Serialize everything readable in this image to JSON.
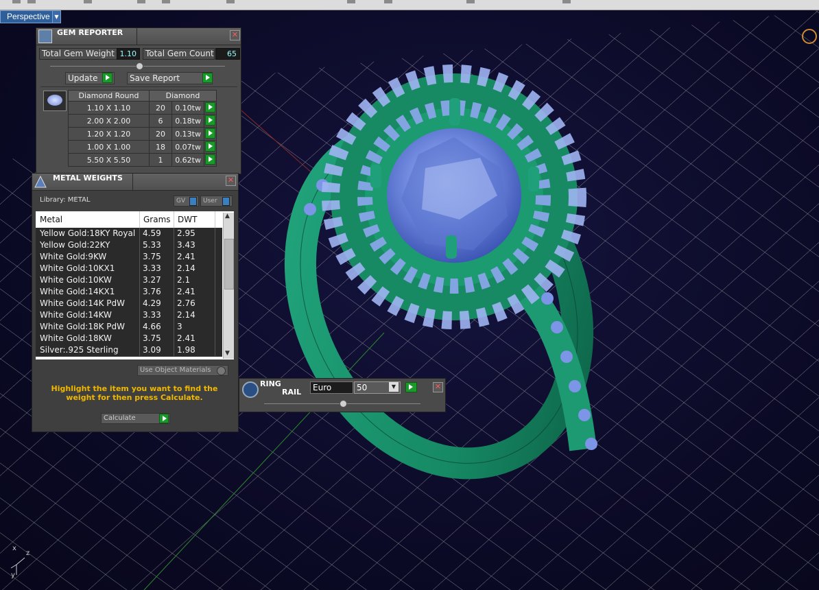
{
  "viewport": {
    "label": "Perspective",
    "axes": {
      "x": "x",
      "y": "y",
      "z": "z"
    }
  },
  "gem_reporter": {
    "title": "GEM REPORTER",
    "total_weight_label": "Total Gem Weight",
    "total_weight_value": "1.10",
    "total_count_label": "Total Gem Count",
    "total_count_value": "65",
    "update_label": "Update",
    "save_report_label": "Save Report",
    "table_headers": [
      "Diamond Round",
      "Diamond"
    ],
    "rows": [
      {
        "size": "1.10 X 1.10",
        "count": "20",
        "weight": "0.10tw"
      },
      {
        "size": "2.00 X 2.00",
        "count": "6",
        "weight": "0.18tw"
      },
      {
        "size": "1.20 X 1.20",
        "count": "20",
        "weight": "0.13tw"
      },
      {
        "size": "1.00 X 1.00",
        "count": "18",
        "weight": "0.07tw"
      },
      {
        "size": "5.50 X 5.50",
        "count": "1",
        "weight": "0.62tw"
      }
    ]
  },
  "metal_weights": {
    "title": "METAL WEIGHTS",
    "library_label": "Library: METAL",
    "gv_label": "GV",
    "user_label": "User",
    "columns": [
      "Metal",
      "Grams",
      "DWT"
    ],
    "rows": [
      {
        "metal": "Yellow Gold:18KY Royal",
        "grams": "4.59",
        "dwt": "2.95"
      },
      {
        "metal": "Yellow Gold:22KY",
        "grams": "5.33",
        "dwt": "3.43"
      },
      {
        "metal": "White Gold:9KW",
        "grams": "3.75",
        "dwt": "2.41"
      },
      {
        "metal": "White Gold:10KX1",
        "grams": "3.33",
        "dwt": "2.14"
      },
      {
        "metal": "White Gold:10KW",
        "grams": "3.27",
        "dwt": "2.1"
      },
      {
        "metal": "White Gold:14KX1",
        "grams": "3.76",
        "dwt": "2.41"
      },
      {
        "metal": "White Gold:14K PdW",
        "grams": "4.29",
        "dwt": "2.76"
      },
      {
        "metal": "White Gold:14KW",
        "grams": "3.33",
        "dwt": "2.14"
      },
      {
        "metal": "White Gold:18K PdW",
        "grams": "4.66",
        "dwt": "3"
      },
      {
        "metal": "White Gold:18KW",
        "grams": "3.75",
        "dwt": "2.41"
      },
      {
        "metal": "Silver:.925 Sterling",
        "grams": "3.09",
        "dwt": "1.98"
      }
    ],
    "use_object_materials_label": "Use Object Materials",
    "instruction": "Highlight the item you want to find the weight for then press Calculate.",
    "calculate_label": "Calculate"
  },
  "ring_rail": {
    "title_line1": "RING",
    "title_line2": "RAIL",
    "standard_value": "Euro",
    "size_value": "50"
  },
  "colors": {
    "ring": "#1a8f6b",
    "gem": "#6f8fe8",
    "grid": "#c8c8c8",
    "accent_yellow": "#f0b800",
    "button_green": "#1a9a2a"
  }
}
